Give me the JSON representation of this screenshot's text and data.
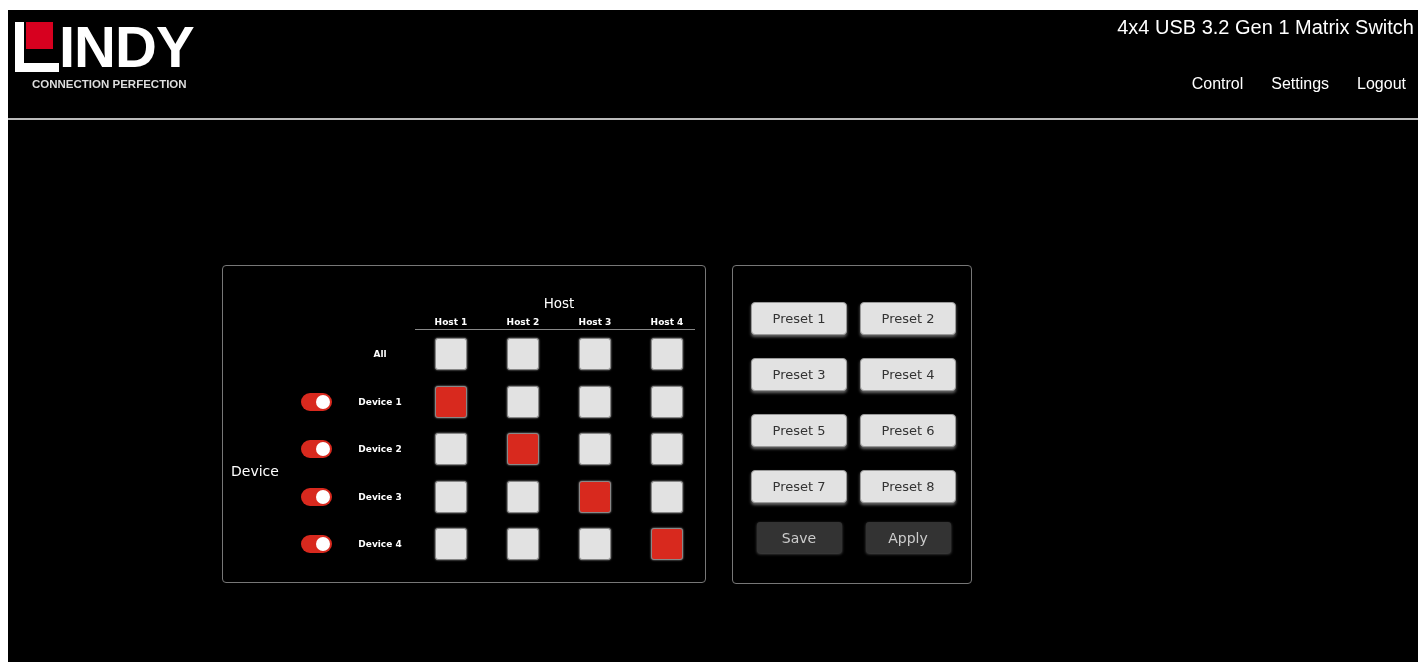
{
  "header": {
    "logo": {
      "text": "INDY",
      "tagline": "CONNECTION PERFECTION"
    },
    "title": "4x4 USB 3.2 Gen 1 Matrix Switch",
    "nav": [
      {
        "label": "Control"
      },
      {
        "label": "Settings"
      },
      {
        "label": "Logout"
      }
    ]
  },
  "matrix": {
    "host_title": "Host",
    "device_title": "Device",
    "hosts": [
      "Host 1",
      "Host 2",
      "Host 3",
      "Host 4"
    ],
    "all_row": {
      "label": "All",
      "cells": [
        {
          "selected": false
        },
        {
          "selected": false
        },
        {
          "selected": false
        },
        {
          "selected": false
        }
      ]
    },
    "devices": [
      {
        "label": "Device 1",
        "on": true,
        "cells": [
          {
            "selected": true
          },
          {
            "selected": false
          },
          {
            "selected": false
          },
          {
            "selected": false
          }
        ]
      },
      {
        "label": "Device 2",
        "on": true,
        "cells": [
          {
            "selected": false
          },
          {
            "selected": true
          },
          {
            "selected": false
          },
          {
            "selected": false
          }
        ]
      },
      {
        "label": "Device 3",
        "on": true,
        "cells": [
          {
            "selected": false
          },
          {
            "selected": false
          },
          {
            "selected": true
          },
          {
            "selected": false
          }
        ]
      },
      {
        "label": "Device 4",
        "on": true,
        "cells": [
          {
            "selected": false
          },
          {
            "selected": false
          },
          {
            "selected": false
          },
          {
            "selected": true
          }
        ]
      }
    ]
  },
  "presets": {
    "buttons": [
      "Preset 1",
      "Preset 2",
      "Preset 3",
      "Preset 4",
      "Preset 5",
      "Preset 6",
      "Preset 7",
      "Preset 8"
    ],
    "actions": [
      "Save",
      "Apply"
    ]
  }
}
